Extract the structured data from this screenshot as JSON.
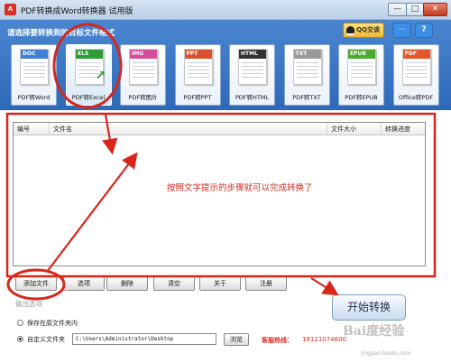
{
  "window": {
    "icon_text": "A",
    "title": "PDF转换成Word转换器 试用版",
    "minimize": "—",
    "maximize": "□",
    "close": "✕"
  },
  "header": {
    "prompt": "请选择要转换到的目标文件格式",
    "qq_label": "QQ交谈",
    "chat_icon": "speech-bubble",
    "help_icon": "question-mark",
    "chat_glyph": "···",
    "help_glyph": "?",
    "formats": [
      {
        "badge": "DOC",
        "label": "PDF转Word",
        "color": "#3f7fd6"
      },
      {
        "badge": "XLS",
        "label": "PDF转Excel",
        "color": "#2e9b35",
        "selected": true
      },
      {
        "badge": "IMG",
        "label": "PDF转图片",
        "color": "#d44c9a"
      },
      {
        "badge": "PPT",
        "label": "PDF转PPT",
        "color": "#d9532c"
      },
      {
        "badge": "HTML",
        "label": "PDF转HTML",
        "color": "#333333"
      },
      {
        "badge": "TXT",
        "label": "PDF转TXT",
        "color": "#9a9a9a"
      },
      {
        "badge": "EPUB",
        "label": "PDF转EPUB",
        "color": "#4caa2f"
      },
      {
        "badge": "PDF",
        "label": "Office转PDF",
        "color": "#e0582a"
      }
    ]
  },
  "table": {
    "columns": [
      "编号",
      "文件名",
      "文件大小",
      "转换进度"
    ],
    "hint": "按照文字提示的步骤就可以完成转换了"
  },
  "buttons": {
    "add_file": "添加文件",
    "options": "选项",
    "delete": "删除",
    "clear": "清空",
    "about": "关于",
    "register": "注册",
    "start": "开始转换"
  },
  "output": {
    "section_label": "输出选项",
    "keep_in_source": "保存在原文件夹内",
    "custom_folder": "自定义文件夹",
    "path": "C:\\Users\\Administrator\\Desktop",
    "browse": "浏览",
    "hotline_label": "客服热线：",
    "hotline_number": "18121074600"
  },
  "watermark": {
    "text": "Bai度经验",
    "url": "jingyan.baidu.com"
  },
  "colors": {
    "header_blue": "#3a78c6",
    "hint_red": "#d42a1c",
    "annotation_red": "#d8261a"
  }
}
